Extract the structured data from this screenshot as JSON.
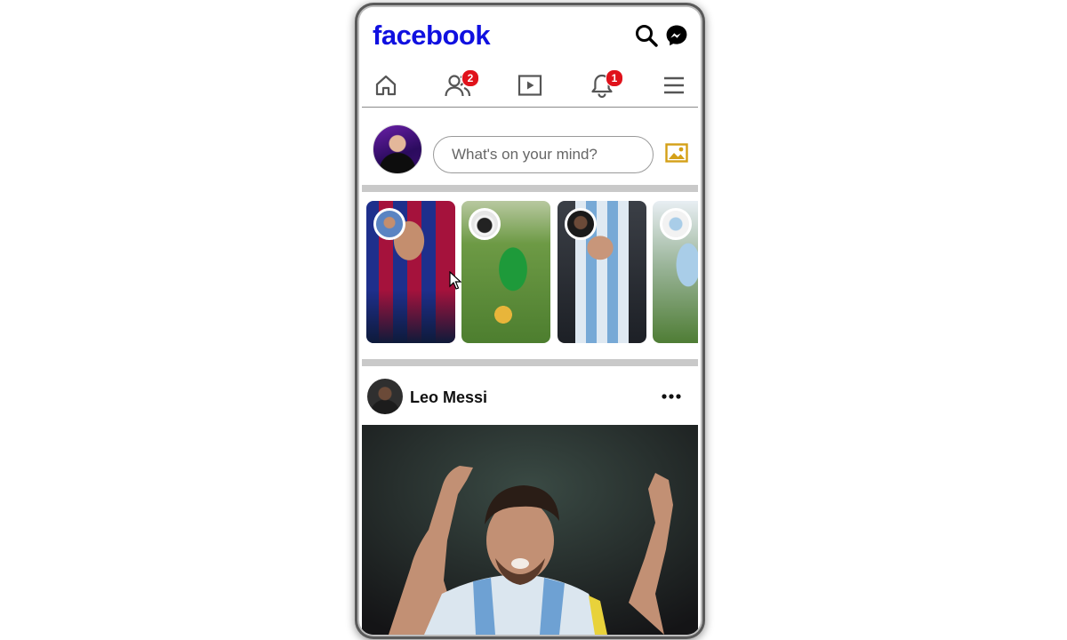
{
  "header": {
    "logo_text": "facebook",
    "brand_color": "#1010e0",
    "icons": [
      "search-icon",
      "messenger-icon"
    ]
  },
  "nav": {
    "items": [
      {
        "name": "home",
        "icon": "home-icon"
      },
      {
        "name": "friends",
        "icon": "friends-icon",
        "badge": "2"
      },
      {
        "name": "watch",
        "icon": "video-icon"
      },
      {
        "name": "notifications",
        "icon": "bell-icon",
        "badge": "1"
      },
      {
        "name": "menu",
        "icon": "hamburger-icon"
      }
    ],
    "badge_color": "#e0121b"
  },
  "composer": {
    "placeholder": "What's on your mind?",
    "photo_icon_color": "#d4a017"
  },
  "stories": [
    {
      "name": "story-1",
      "theme": "barcelona-player"
    },
    {
      "name": "story-2",
      "theme": "kid-football"
    },
    {
      "name": "story-3",
      "theme": "argentina-player"
    },
    {
      "name": "story-4",
      "theme": "kid-sky-blue"
    }
  ],
  "post": {
    "author": "Leo Messi",
    "more_icon": "more-dots-icon"
  }
}
